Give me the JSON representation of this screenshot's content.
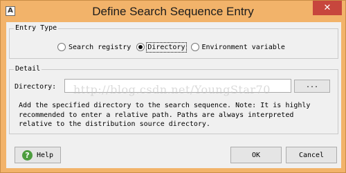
{
  "window": {
    "title": "Define Search Sequence Entry",
    "icon": "app-icon",
    "close_glyph": "✕"
  },
  "entry_type": {
    "legend": "Entry Type",
    "options": [
      {
        "label": "Search registry",
        "selected": false
      },
      {
        "label": "Directory",
        "selected": true
      },
      {
        "label": "Environment variable",
        "selected": false
      }
    ]
  },
  "detail": {
    "legend": "Detail",
    "directory_label": "Directory:",
    "directory_value": "",
    "browse_label": "...",
    "description": "Add the specified directory to the search sequence. Note: It is highly\nrecommended to enter a relative path. Paths are always interpreted\nrelative to the distribution source directory."
  },
  "buttons": {
    "help": "Help",
    "ok": "OK",
    "cancel": "Cancel"
  },
  "watermark": "http://blog.csdn.net/YoungStar70",
  "colors": {
    "frame": "#f2b36a",
    "close": "#c7463d",
    "help_icon": "#4d9d3f"
  }
}
